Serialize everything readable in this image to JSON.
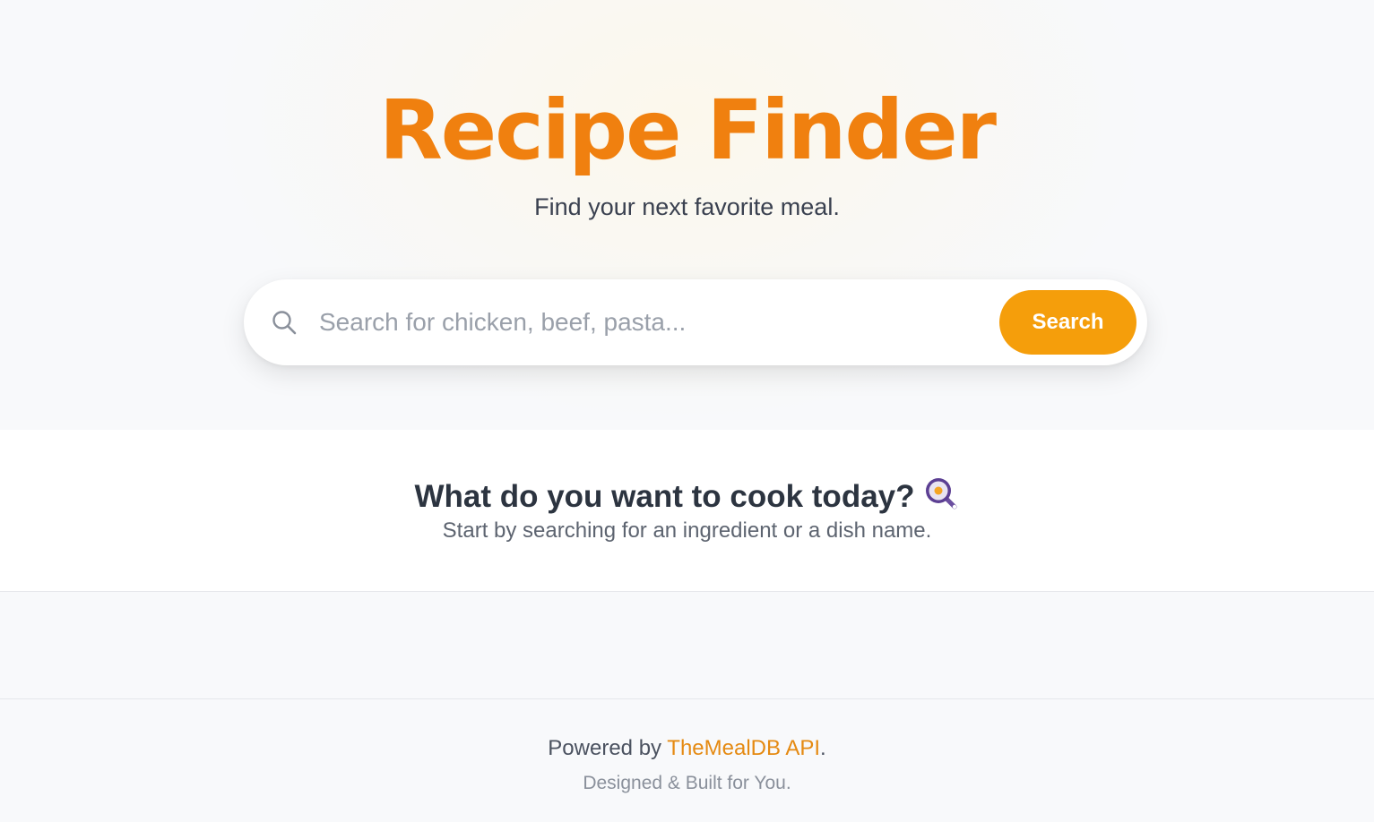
{
  "hero": {
    "title": "Recipe Finder",
    "subtitle": "Find your next favorite meal."
  },
  "search": {
    "placeholder": "Search for chicken, beef, pasta...",
    "value": "",
    "button_label": "Search",
    "icon": "search-icon"
  },
  "welcome": {
    "heading": "What do you want to cook today?",
    "icon": "frying-pan-icon",
    "subtext": "Start by searching for an ingredient or a dish name."
  },
  "footer": {
    "prefix": "Powered by ",
    "link_text": "TheMealDB API",
    "suffix": ".",
    "tagline": "Designed & Built for You."
  },
  "colors": {
    "accent": "#f59e0b",
    "title": "#f0800f",
    "link": "#e58a12"
  }
}
